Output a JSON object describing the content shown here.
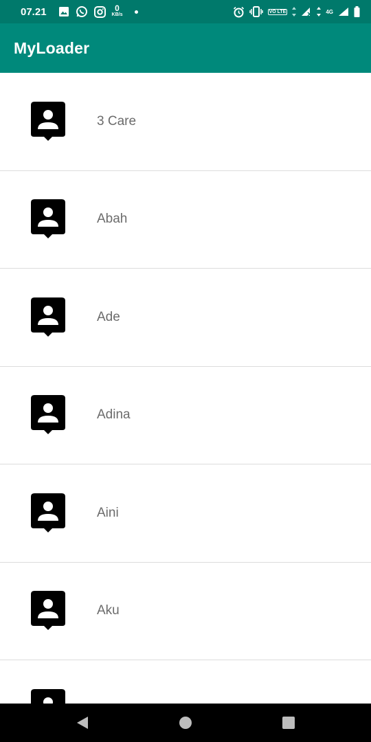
{
  "status_bar": {
    "time": "07.21",
    "netspeed_value": "0",
    "netspeed_unit": "KB/s",
    "volte_label": "VO LTE",
    "network_type": "4G",
    "icons": [
      "image-icon",
      "whatsapp-icon",
      "instagram-icon",
      "alarm-icon",
      "vibrate-icon",
      "signal-icon",
      "battery-icon"
    ]
  },
  "app_bar": {
    "title": "MyLoader"
  },
  "contacts": [
    {
      "name": "3 Care"
    },
    {
      "name": "Abah"
    },
    {
      "name": "Ade"
    },
    {
      "name": "Adina"
    },
    {
      "name": "Aini"
    },
    {
      "name": "Aku"
    },
    {
      "name": ""
    }
  ],
  "colors": {
    "status_bar": "#00796b",
    "app_bar": "#00897b",
    "contact_text": "#6b6b6b",
    "nav_bar": "#000000"
  },
  "nav": {
    "icons": [
      "back-icon",
      "home-icon",
      "recents-icon"
    ]
  }
}
